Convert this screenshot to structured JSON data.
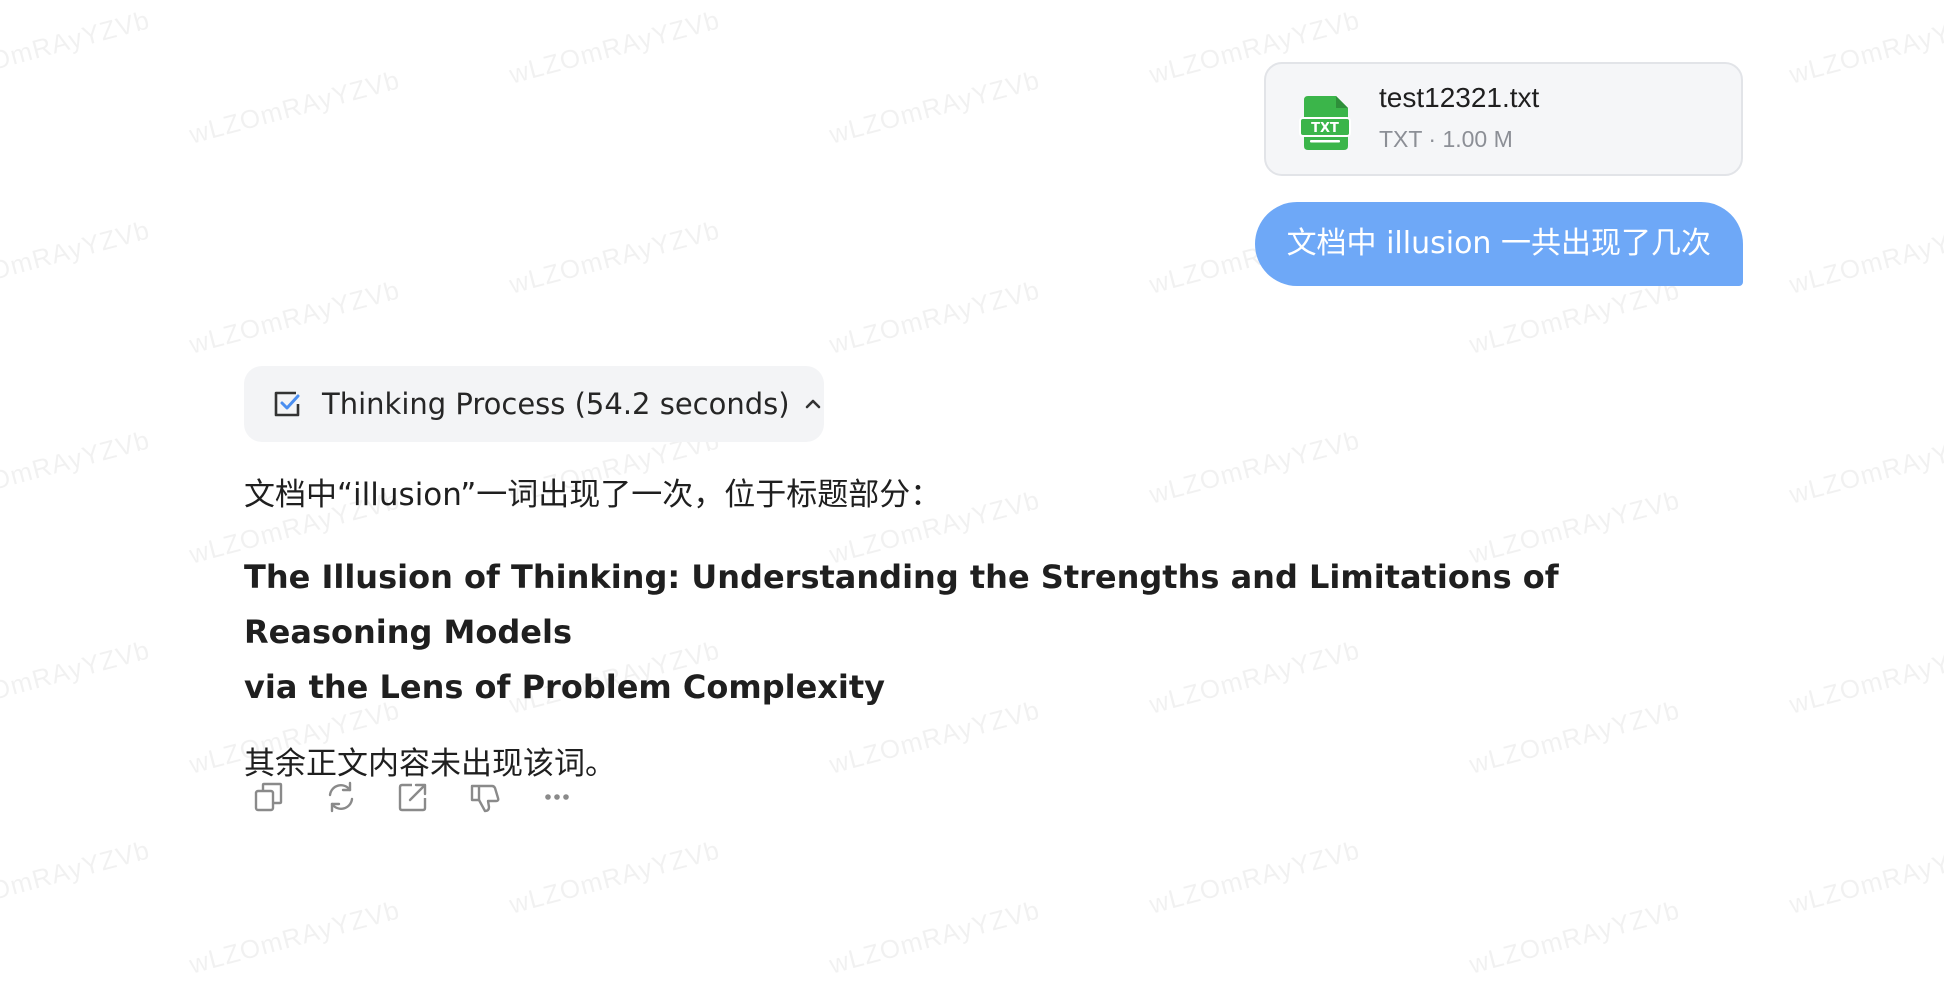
{
  "watermark_text": "wLZOmRAyYZVb",
  "attachment": {
    "icon": "txt-file-icon",
    "icon_badge": "TXT",
    "name": "test12321.txt",
    "meta": "TXT · 1.00 M",
    "icon_color": "#3bb54a"
  },
  "user_message": {
    "text": "文档中 illusion 一共出现了几次",
    "bubble_color": "#6ea8f7"
  },
  "thinking": {
    "icon": "checklist-icon",
    "label": "Thinking Process (54.2 seconds)",
    "toggle_icon": "chevron-up-icon"
  },
  "answer": {
    "intro": "文档中“illusion”一词出现了一次，位于标题部分：",
    "title_line1": "The Illusion of Thinking: Understanding the Strengths and Limitations of Reasoning Models",
    "title_line2": "via the Lens of Problem Complexity",
    "outro": "其余正文内容未出现该词。"
  },
  "actions": [
    {
      "name": "copy",
      "icon": "copy-icon"
    },
    {
      "name": "regenerate",
      "icon": "refresh-icon"
    },
    {
      "name": "share",
      "icon": "share-icon"
    },
    {
      "name": "dislike",
      "icon": "thumbs-down-icon"
    },
    {
      "name": "more",
      "icon": "more-icon"
    }
  ]
}
